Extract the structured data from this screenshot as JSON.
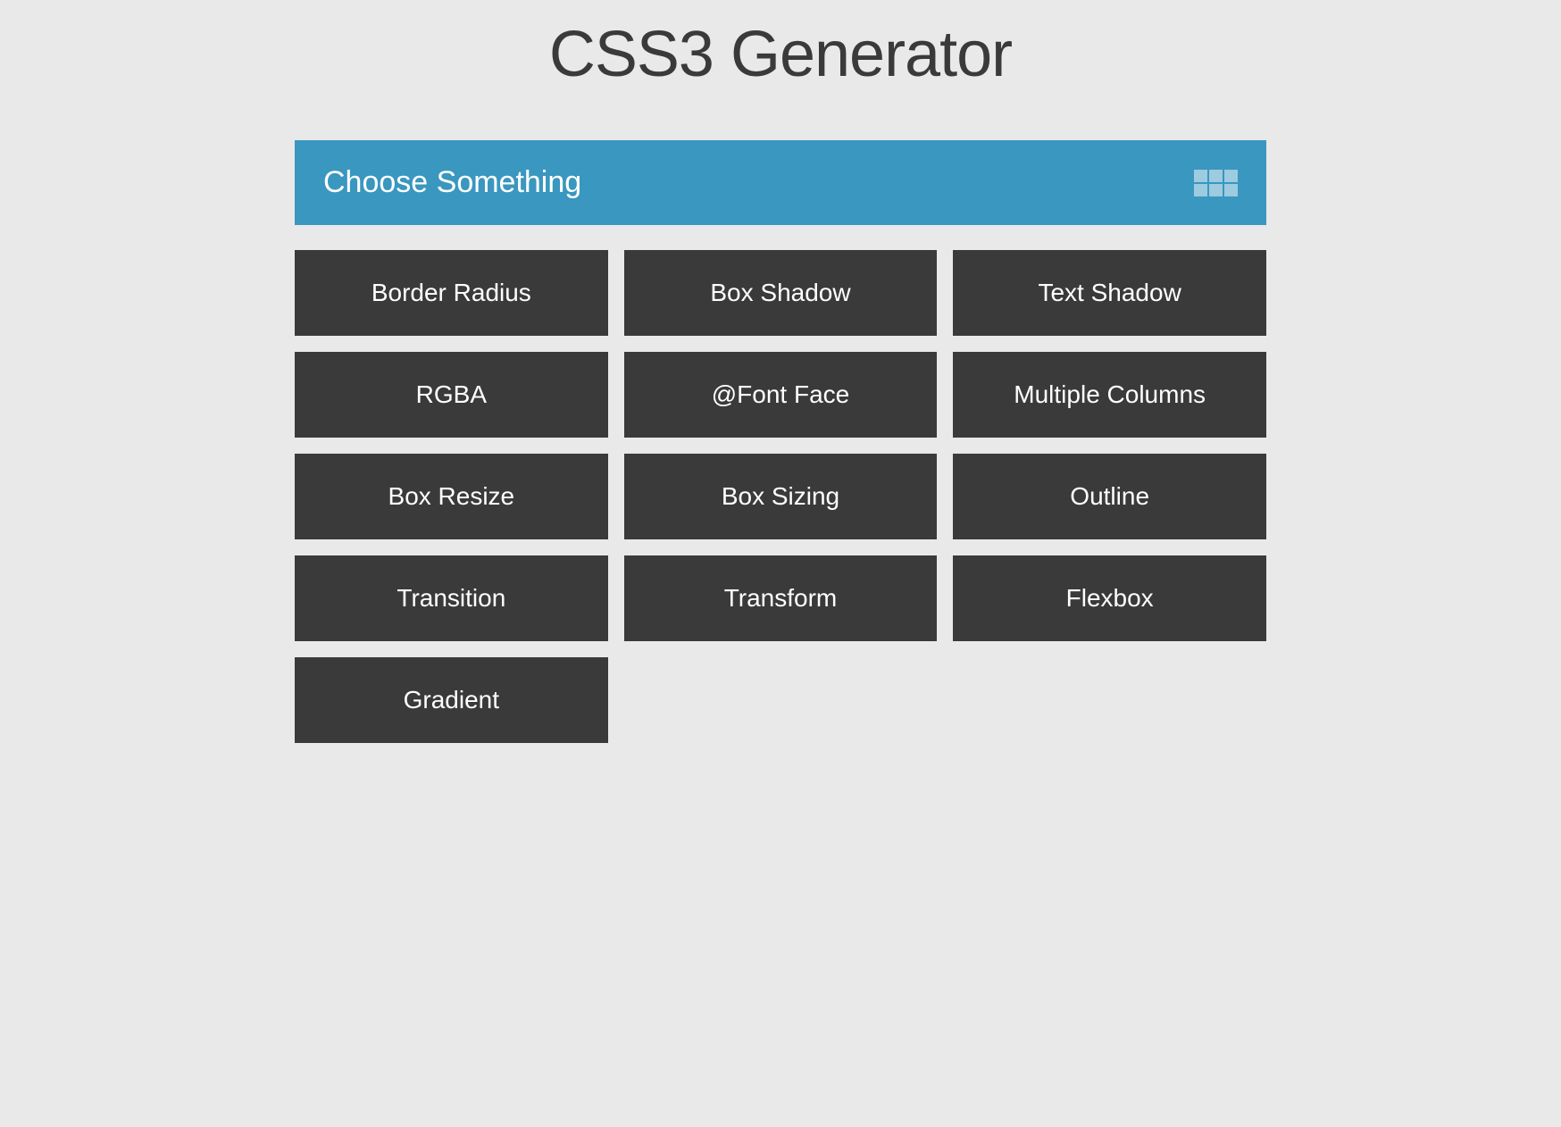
{
  "title": "CSS3 Generator",
  "dropdown": {
    "label": "Choose Something"
  },
  "options": [
    {
      "label": "Border Radius",
      "key": "border-radius"
    },
    {
      "label": "Box Shadow",
      "key": "box-shadow"
    },
    {
      "label": "Text Shadow",
      "key": "text-shadow"
    },
    {
      "label": "RGBA",
      "key": "rgba"
    },
    {
      "label": "@Font Face",
      "key": "font-face"
    },
    {
      "label": "Multiple Columns",
      "key": "multiple-columns"
    },
    {
      "label": "Box Resize",
      "key": "box-resize"
    },
    {
      "label": "Box Sizing",
      "key": "box-sizing"
    },
    {
      "label": "Outline",
      "key": "outline"
    },
    {
      "label": "Transition",
      "key": "transition"
    },
    {
      "label": "Transform",
      "key": "transform"
    },
    {
      "label": "Flexbox",
      "key": "flexbox"
    },
    {
      "label": "Gradient",
      "key": "gradient"
    }
  ],
  "colors": {
    "background": "#e9e9e9",
    "accent": "#3a97bf",
    "tile": "#3a3a3a",
    "text_light": "#ffffff",
    "text_dark": "#3a3a3a"
  }
}
